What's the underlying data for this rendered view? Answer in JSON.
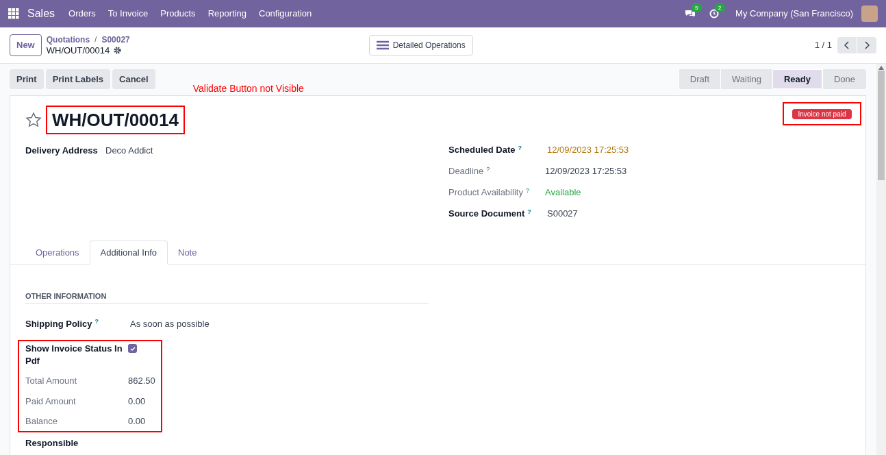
{
  "navbar": {
    "app": "Sales",
    "menu": [
      "Orders",
      "To Invoice",
      "Products",
      "Reporting",
      "Configuration"
    ],
    "messages_count": "5",
    "activities_count": "2",
    "company": "My Company (San Francisco)"
  },
  "control_panel": {
    "new_button": "New",
    "breadcrumbs": [
      "Quotations",
      "S00027"
    ],
    "breadcrumb_separator": "/",
    "record": "WH/OUT/00014",
    "detailed_operations": "Detailed Operations",
    "pager": "1 / 1"
  },
  "actions": [
    "Print",
    "Print Labels",
    "Cancel"
  ],
  "note": "Validate Button not Visible",
  "statusbar": [
    {
      "label": "Draft",
      "selected": false
    },
    {
      "label": "Waiting",
      "selected": false
    },
    {
      "label": "Ready",
      "selected": true
    },
    {
      "label": "Done",
      "selected": false
    }
  ],
  "sheet": {
    "title": "WH/OUT/00014",
    "starred": false,
    "ribbon": "Invoice not paid",
    "left_fields": [
      {
        "label": "Delivery Address",
        "value": "Deco Addict",
        "readonly": false,
        "kind": "normal"
      }
    ],
    "right_fields": [
      {
        "label": "Scheduled Date",
        "help": "?",
        "value": "12/09/2023 17:25:53",
        "readonly": false,
        "kind": "warning"
      },
      {
        "label": "Deadline",
        "help": "?",
        "value": "12/09/2023 17:25:53",
        "readonly": true,
        "kind": "normal"
      },
      {
        "label": "Product Availability",
        "help": "?",
        "value": "Available",
        "readonly": true,
        "kind": "success"
      },
      {
        "label": "Source Document",
        "help": "?",
        "value": "S00027",
        "readonly": false,
        "kind": "normal"
      }
    ],
    "tabs": [
      {
        "label": "Operations",
        "selected": false
      },
      {
        "label": "Additional Info",
        "selected": true
      },
      {
        "label": "Note",
        "selected": false
      }
    ],
    "section_title": "OTHER INFORMATION",
    "shipping_policy": {
      "label": "Shipping Policy",
      "help": "?",
      "value": "As soon as possible"
    },
    "invoice_status": {
      "label": "Show Invoice Status In Pdf",
      "checked": true
    },
    "amounts": [
      {
        "label": "Total Amount",
        "value": "862.50"
      },
      {
        "label": "Paid Amount",
        "value": "0.00"
      },
      {
        "label": "Balance",
        "value": "0.00"
      }
    ],
    "responsible": {
      "label": "Responsible"
    }
  }
}
